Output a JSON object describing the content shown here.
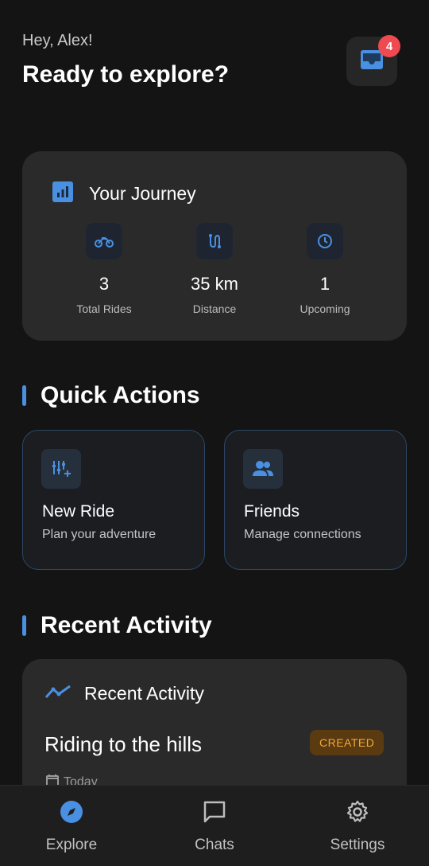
{
  "header": {
    "greeting": "Hey, Alex!",
    "headline": "Ready to explore?",
    "inbox_badge": "4"
  },
  "journey": {
    "title": "Your Journey",
    "stats": [
      {
        "icon": "motorcycle-icon",
        "value": "3",
        "label": "Total Rides"
      },
      {
        "icon": "route-icon",
        "value": "35 km",
        "label": "Distance"
      },
      {
        "icon": "clock-icon",
        "value": "1",
        "label": "Upcoming"
      }
    ]
  },
  "quick_actions": {
    "title": "Quick Actions",
    "items": [
      {
        "icon": "new-ride-icon",
        "title": "New Ride",
        "subtitle": "Plan your adventure"
      },
      {
        "icon": "friends-icon",
        "title": "Friends",
        "subtitle": "Manage connections"
      }
    ]
  },
  "recent_activity": {
    "title": "Recent Activity",
    "card_title": "Recent Activity",
    "ride_title": "Riding to the hills",
    "status": "CREATED",
    "date": "Today"
  },
  "nav": {
    "items": [
      {
        "icon": "compass-icon",
        "label": "Explore"
      },
      {
        "icon": "chat-icon",
        "label": "Chats"
      },
      {
        "icon": "gear-icon",
        "label": "Settings"
      }
    ]
  },
  "colors": {
    "accent": "#4a90e2",
    "background": "#141414",
    "card": "#2a2a2a",
    "badge": "#ef4a4f",
    "status_created": "#f0a83a"
  }
}
